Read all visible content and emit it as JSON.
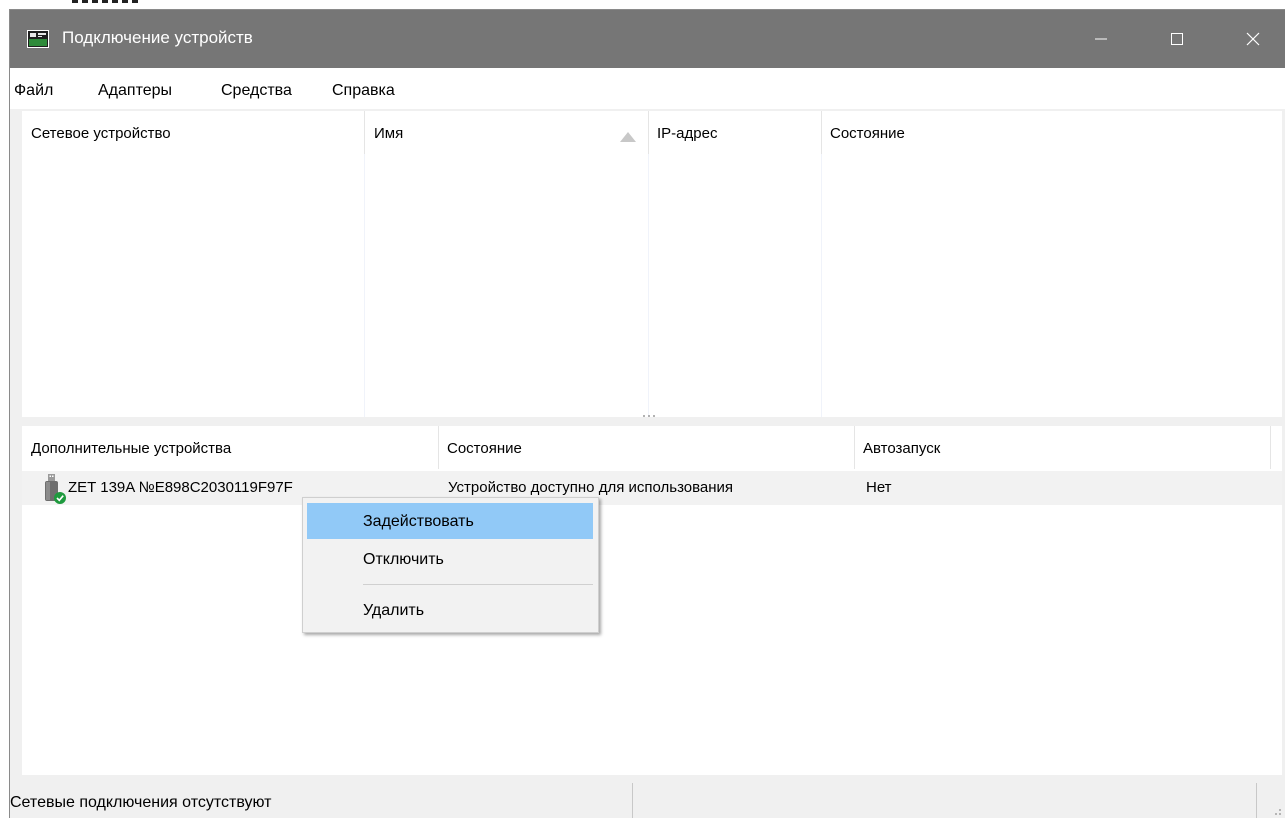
{
  "window": {
    "title": "Подключение устройств",
    "titlebar_color": "#767676"
  },
  "menu": [
    "Файл",
    "Адаптеры",
    "Средства",
    "Справка"
  ],
  "top_table": {
    "columns": [
      "Сетевое устройство",
      "Имя",
      "IP-адрес",
      "Состояние"
    ],
    "sorted_column": "Имя",
    "sort_direction": "ascending",
    "rows": []
  },
  "bottom_table": {
    "columns": [
      "Дополнительные устройства",
      "Состояние",
      "Автозапуск"
    ],
    "rows": [
      {
        "icon": "usb-device-icon",
        "device": "ZET 139A №E898C2030119F97F",
        "state": "Устройство доступно для использования",
        "autostart": "Нет"
      }
    ]
  },
  "context_menu": {
    "items": [
      "Задействовать",
      "Отключить",
      "Удалить"
    ],
    "highlighted": "Задействовать",
    "highlight_color": "#91c9f7"
  },
  "statusbar": {
    "text": "Сетевые подключения отсутствуют"
  },
  "icons": {
    "app": "network-device-app-icon",
    "minimize": "minimize-icon",
    "maximize": "maximize-icon",
    "close": "close-icon",
    "sort": "sort-up-arrow-icon",
    "device": "usb-device-icon",
    "status_ok": "check-badge-icon"
  }
}
